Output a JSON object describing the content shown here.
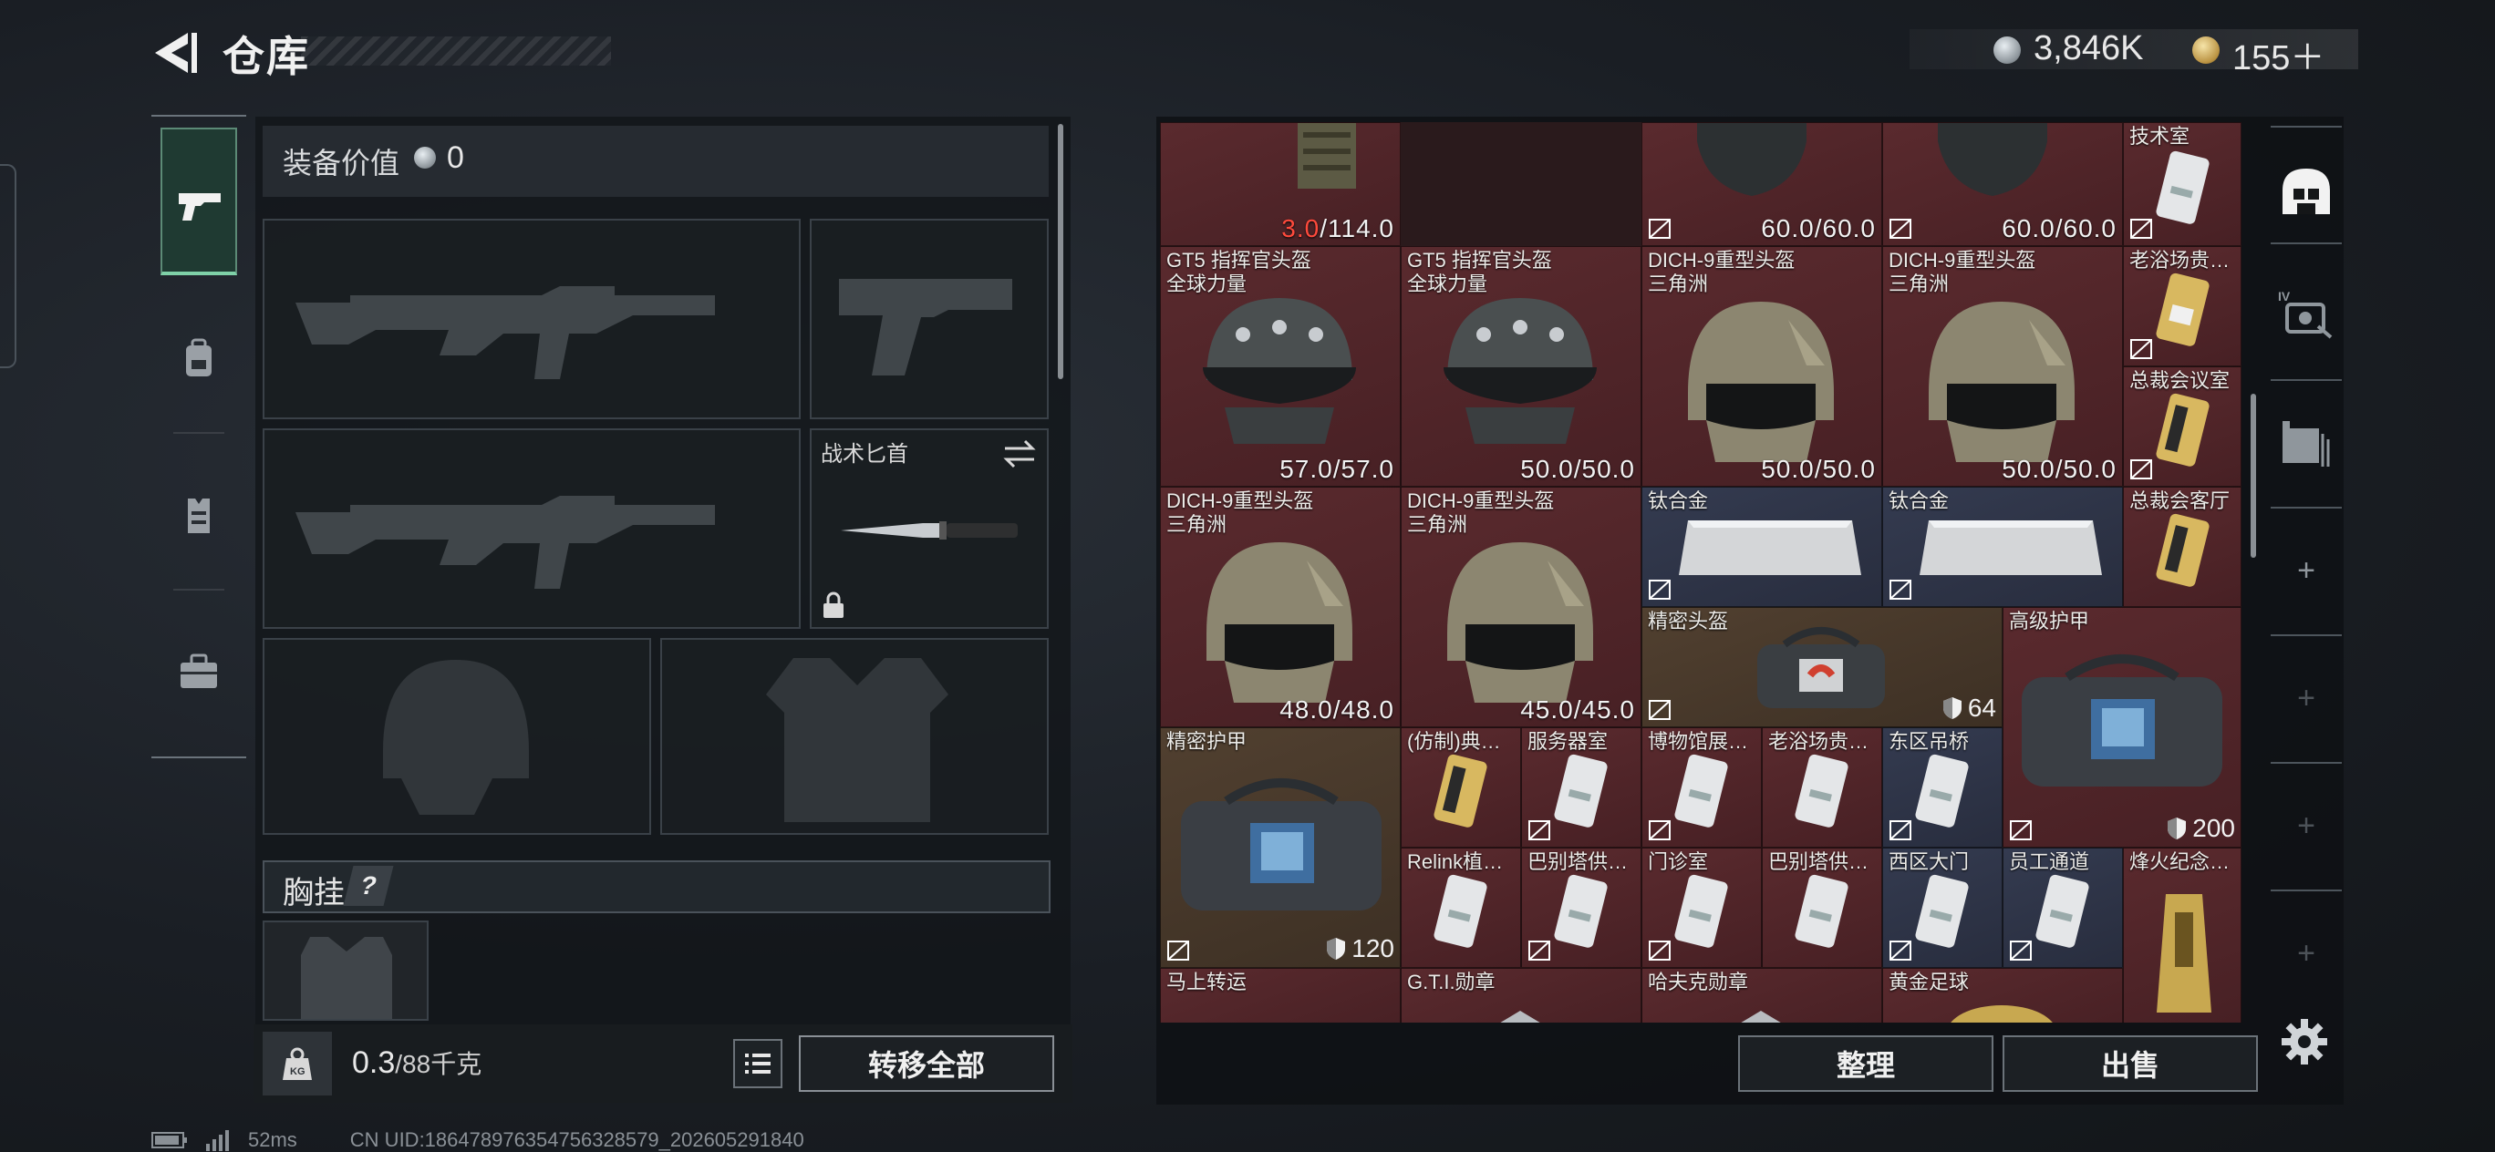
{
  "header": {
    "title": "仓库",
    "back_icon": "chevron-left-icon"
  },
  "currency": {
    "coins": "3,846K",
    "premium": "155＋"
  },
  "loadout": {
    "equipment_value_label": "装备价值",
    "equipment_value": "0",
    "melee_slot_label": "战术匕首",
    "chest_rig_label": "胸挂",
    "chest_rig_help": "?",
    "weight_value": "0.3",
    "weight_capacity": "/88千克",
    "transfer_all_label": "转移全部"
  },
  "stash": {
    "items": [
      {
        "name": "",
        "dur_low": "3.0",
        "dur": "/114.0"
      },
      {
        "name": "",
        "dur": "60.0/60.0"
      },
      {
        "name": "",
        "dur": "60.0/60.0"
      },
      {
        "name": "技术室"
      },
      {
        "name": "GT5 指挥官头盔",
        "sub": "全球力量",
        "dur": "57.0/57.0"
      },
      {
        "name": "GT5 指挥官头盔",
        "sub": "全球力量",
        "dur": "50.0/50.0"
      },
      {
        "name": "DICH-9重型头盔",
        "sub": "三角洲",
        "dur": "50.0/50.0"
      },
      {
        "name": "DICH-9重型头盔",
        "sub": "三角洲",
        "dur": "50.0/50.0"
      },
      {
        "name": "老浴场贵…"
      },
      {
        "name": "总裁会议室"
      },
      {
        "name": "DICH-9重型头盔",
        "sub": "三角洲",
        "dur": "48.0/48.0"
      },
      {
        "name": "DICH-9重型头盔",
        "sub": "三角洲",
        "dur": "45.0/45.0"
      },
      {
        "name": "钛合金"
      },
      {
        "name": "钛合金"
      },
      {
        "name": "总裁会客厅"
      },
      {
        "name": "精密头盔",
        "armor": "64"
      },
      {
        "name": "高级护甲",
        "armor": "200"
      },
      {
        "name": "精密护甲",
        "armor": "120"
      },
      {
        "name": "(仿制)典…"
      },
      {
        "name": "服务器室"
      },
      {
        "name": "博物馆展…"
      },
      {
        "name": "老浴场贵…"
      },
      {
        "name": "东区吊桥"
      },
      {
        "name": "Relink植…"
      },
      {
        "name": "巴别塔供…"
      },
      {
        "name": "门诊室"
      },
      {
        "name": "巴别塔供…"
      },
      {
        "name": "西区大门"
      },
      {
        "name": "员工通道"
      },
      {
        "name": "烽火纪念…"
      },
      {
        "name": "马上转运"
      },
      {
        "name": "G.T.I.勋章"
      },
      {
        "name": "哈夫克勋章"
      },
      {
        "name": "黄金足球"
      }
    ],
    "sort_label": "整理",
    "sell_label": "出售"
  },
  "status_bar": {
    "ping": "52ms",
    "uid": "CN UID:18647897635475632857​9_202605291840"
  },
  "colors": {
    "accent_green": "#7fd1a8",
    "durability_low": "#ff4a3c",
    "red_rarity": "#5a2a2e",
    "gold_rarity": "#514030",
    "blue_rarity": "#343b50"
  }
}
